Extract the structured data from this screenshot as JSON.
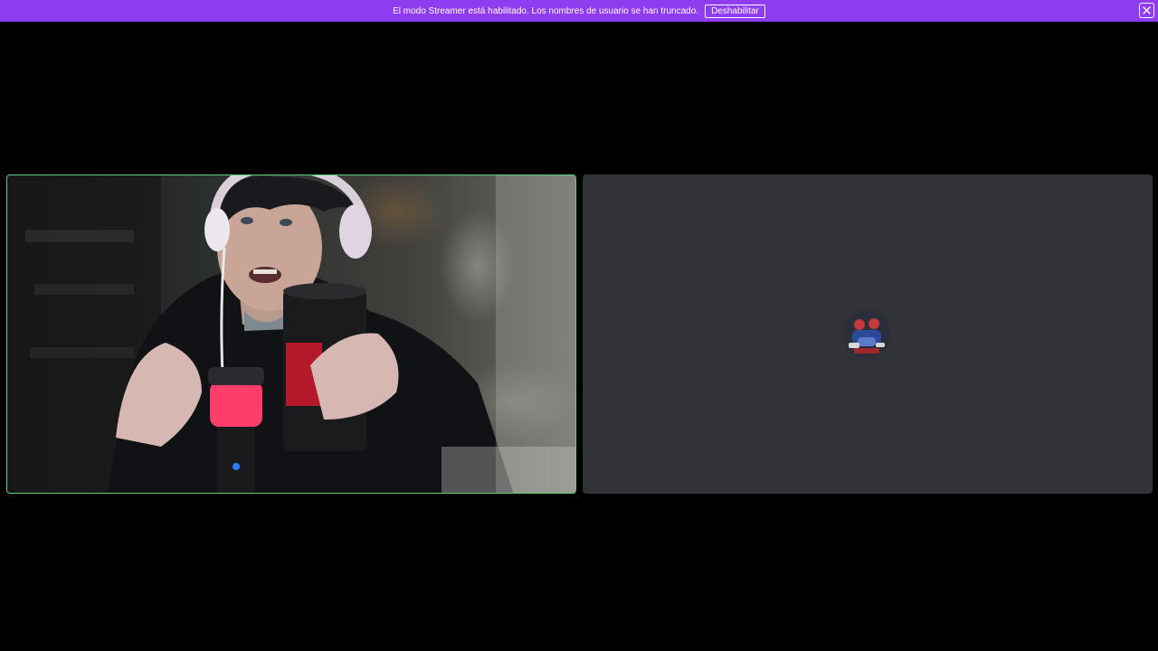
{
  "banner": {
    "message": "El modo Streamer está habilitado. Los nombres de usuario se han truncado.",
    "disable_label": "Deshabilitar",
    "close_icon": "close-icon",
    "background_color": "#8f3bf0"
  },
  "call": {
    "tiles": [
      {
        "type": "video",
        "speaking": true,
        "speaking_color": "#5ad27a"
      },
      {
        "type": "audio-only",
        "avatar_icon": "user-avatar",
        "background_color": "#313338"
      }
    ]
  }
}
